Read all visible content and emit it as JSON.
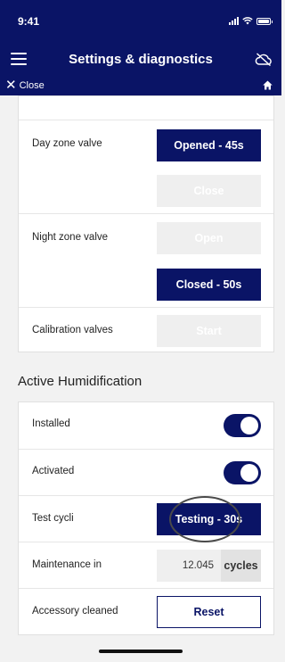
{
  "status_bar": {
    "time": "9:41"
  },
  "header": {
    "title": "Settings & diagnostics",
    "menu_icon": "hamburger-menu-icon",
    "right_icon": "cloud-off-icon"
  },
  "close_bar": {
    "close_label": "Close",
    "close_icon": "close-icon",
    "home_icon": "home-icon"
  },
  "valves": {
    "rows": [
      {
        "label": "Day zone valve",
        "buttons": [
          {
            "label": "Opened - 45s",
            "state": "active"
          },
          {
            "label": "Close",
            "state": "disabled"
          }
        ]
      },
      {
        "label": "Night zone valve",
        "buttons": [
          {
            "label": "Open",
            "state": "disabled"
          },
          {
            "label": "Closed - 50s",
            "state": "active"
          }
        ]
      },
      {
        "label": "Calibration valves",
        "buttons": [
          {
            "label": "Start",
            "state": "disabled"
          }
        ]
      }
    ]
  },
  "humidification": {
    "title": "Active Humidification",
    "installed": {
      "label": "Installed",
      "on": true
    },
    "activated": {
      "label": "Activated",
      "on": true
    },
    "test_cycli": {
      "label": "Test cycli",
      "button": "Testing - 30s"
    },
    "maintenance": {
      "label": "Maintenance in",
      "value": "12.045",
      "unit": "cycles"
    },
    "accessory": {
      "label": "Accessory cleaned",
      "button": "Reset"
    }
  },
  "colors": {
    "primary": "#0a1466",
    "disabled": "#efefef",
    "background": "#f2f2f2"
  }
}
